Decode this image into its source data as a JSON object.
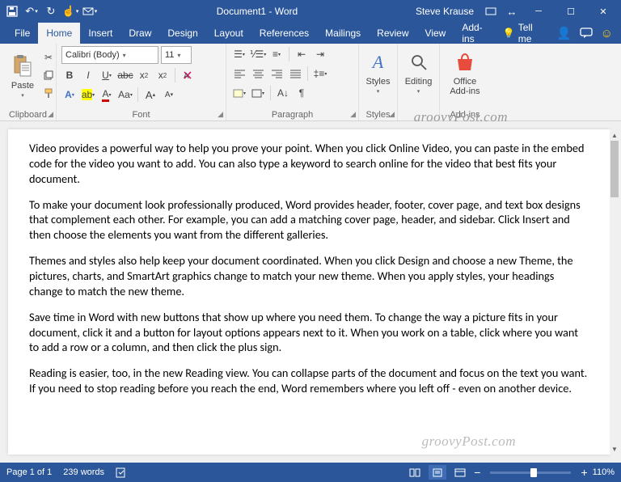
{
  "title": {
    "doc": "Document1 - Word",
    "user": "Steve Krause"
  },
  "tabs": [
    "File",
    "Home",
    "Insert",
    "Draw",
    "Design",
    "Layout",
    "References",
    "Mailings",
    "Review",
    "View",
    "Add-ins"
  ],
  "tell_me": "Tell me",
  "ribbon": {
    "clipboard": {
      "label": "Clipboard",
      "paste": "Paste"
    },
    "font": {
      "label": "Font",
      "name": "Calibri (Body)",
      "size": "11"
    },
    "paragraph": {
      "label": "Paragraph"
    },
    "styles": {
      "label": "Styles",
      "btn": "Styles"
    },
    "editing": {
      "label": "",
      "btn": "Editing"
    },
    "addins": {
      "label": "Add-ins",
      "btn": "Office\nAdd-ins"
    }
  },
  "watermark": "groovyPost.com",
  "document": {
    "p1": "Video provides a powerful way to help you prove your point. When you click Online Video, you can paste in the embed code for the video you want to add. You can also type a keyword to search online for the video that best fits your document.",
    "p2": "To make your document look professionally produced, Word provides header, footer, cover page, and text box designs that complement each other. For example, you can add a matching cover page, header, and sidebar. Click Insert and then choose the elements you want from the different galleries.",
    "p3": "Themes and styles also help keep your document coordinated. When you click Design and choose a new Theme, the pictures, charts, and SmartArt graphics change to match your new theme. When you apply styles, your headings change to match the new theme.",
    "p4": "Save time in Word with new buttons that show up where you need them. To change the way a picture fits in your document, click it and a button for layout options appears next to it. When you work on a table, click where you want to add a row or a column, and then click the plus sign.",
    "p5": "Reading is easier, too, in the new Reading view. You can collapse parts of the document and focus on the text you want. If you need to stop reading before you reach the end, Word remembers where you left off - even on another device."
  },
  "status": {
    "page": "Page 1 of 1",
    "words": "239 words",
    "zoom": "110%"
  }
}
